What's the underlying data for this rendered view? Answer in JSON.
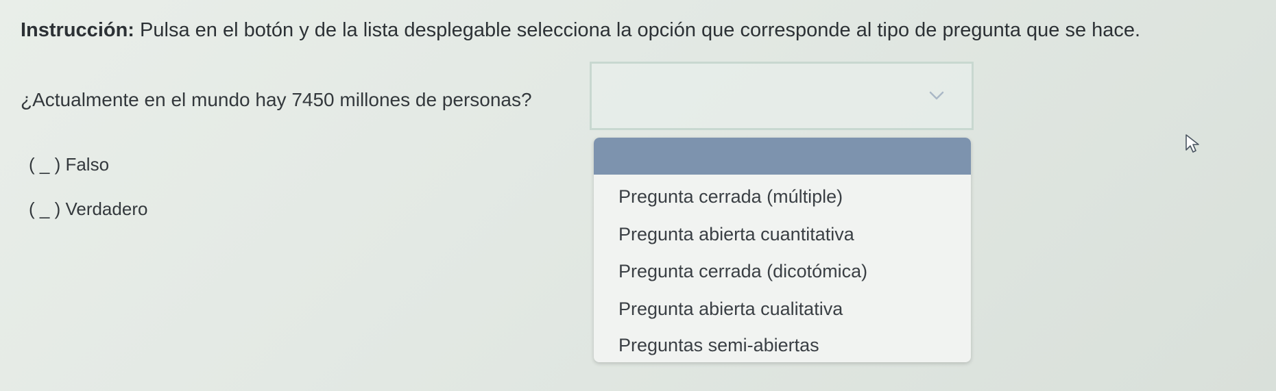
{
  "instruction": {
    "label": "Instrucción:",
    "text": " Pulsa en el botón y de la lista desplegable selecciona la opción que corresponde al tipo de pregunta que se hace."
  },
  "question": {
    "text": "¿Actualmente en el mundo hay 7450 millones de personas?"
  },
  "answer_options": [
    "( _ ) Falso",
    "( _ ) Verdadero"
  ],
  "select": {
    "selected_value": "",
    "icon": "chevron-down-icon"
  },
  "dropdown": {
    "highlighted_index": 0,
    "highlight_color": "#7d93ae",
    "items": [
      "Pregunta cerrada (múltiple)",
      "Pregunta abierta cuantitativa",
      "Pregunta cerrada (dicotómica)",
      "Pregunta abierta cualitativa",
      "Preguntas semi-abiertas"
    ]
  },
  "cursor": {
    "icon": "mouse-pointer-icon"
  }
}
